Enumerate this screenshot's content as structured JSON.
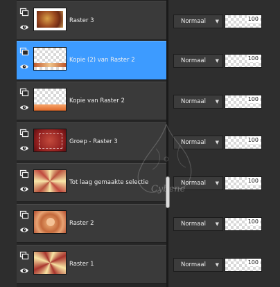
{
  "layers_panel": {
    "layers": [
      {
        "name": "Raster 3",
        "selected": false,
        "thumb": "raster3",
        "blend_mode": "Normaal",
        "opacity": "100"
      },
      {
        "name": "Kopie (2) van Raster 2",
        "selected": true,
        "thumb": "kopie2",
        "blend_mode": "Normaal",
        "opacity": "100"
      },
      {
        "name": "Kopie van Raster 2",
        "selected": false,
        "thumb": "kopie1",
        "blend_mode": "Normaal",
        "opacity": "100"
      },
      {
        "name": "Groep - Raster 3",
        "selected": false,
        "thumb": "groep",
        "blend_mode": "Normaal",
        "opacity": "100"
      },
      {
        "name": "Tot laag gemaakte selectie",
        "selected": false,
        "thumb": "selectie",
        "blend_mode": "Normaal",
        "opacity": "100"
      },
      {
        "name": "Raster 2",
        "selected": false,
        "thumb": "raster2",
        "blend_mode": "Normaal",
        "opacity": "100"
      },
      {
        "name": "Raster 1",
        "selected": false,
        "thumb": "raster1",
        "blend_mode": "Normaal",
        "opacity": "100"
      }
    ],
    "watermark": "Cybene"
  },
  "colors": {
    "panel_bg": "#262626",
    "row_bg": "#3a3a3a",
    "selected_bg": "#3d9bff"
  }
}
